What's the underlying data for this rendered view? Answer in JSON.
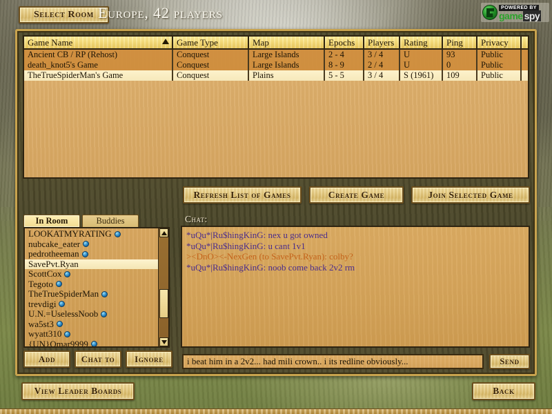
{
  "topbar": {
    "select_room_label": "Select Room",
    "room_title": "Europe, 42 players",
    "logo": {
      "powered_by": "POWERED BY",
      "brand_game": "game",
      "brand_spy": "spy",
      "icon": "gamespy-orb-icon"
    }
  },
  "gamelist": {
    "columns": [
      {
        "label": "Game Name",
        "sorted": true,
        "sort_dir": "asc"
      },
      {
        "label": "Game Type",
        "sorted": false
      },
      {
        "label": "Map",
        "sorted": false
      },
      {
        "label": "Epochs",
        "sorted": false
      },
      {
        "label": "Players",
        "sorted": false
      },
      {
        "label": "Rating",
        "sorted": false
      },
      {
        "label": "Ping",
        "sorted": false
      },
      {
        "label": "Privacy",
        "sorted": false
      }
    ],
    "rows": [
      {
        "name": "Ancient CB / RP (Rehost)",
        "type": "Conquest",
        "map": "Large Islands",
        "epochs": "2 - 4",
        "players": "3 / 4",
        "rating": "U",
        "ping": "93",
        "privacy": "Public",
        "selected": false
      },
      {
        "name": "death_knot5's Game",
        "type": "Conquest",
        "map": "Large Islands",
        "epochs": "8 - 9",
        "players": "2 / 4",
        "rating": "U",
        "ping": "0",
        "privacy": "Public",
        "selected": false
      },
      {
        "name": "TheTrueSpiderMan's Game",
        "type": "Conquest",
        "map": "Plains",
        "epochs": "5 - 5",
        "players": "3 / 4",
        "rating": "S (1961)",
        "ping": "109",
        "privacy": "Public",
        "selected": true
      }
    ]
  },
  "actions": {
    "refresh_label": "Refresh List of Games",
    "create_label": "Create Game",
    "join_label": "Join Selected Game"
  },
  "players_panel": {
    "tabs": [
      {
        "label": "In Room",
        "active": true
      },
      {
        "label": "Buddies",
        "active": false
      }
    ],
    "players": [
      {
        "name": "LOOKATMYRATING",
        "has_globe": true,
        "selected": false
      },
      {
        "name": "nubcake_eater",
        "has_globe": true,
        "selected": false
      },
      {
        "name": "pedrotheeman",
        "has_globe": true,
        "selected": false
      },
      {
        "name": "SavePvt.Ryan",
        "has_globe": false,
        "selected": true
      },
      {
        "name": "ScottCox",
        "has_globe": true,
        "selected": false
      },
      {
        "name": "Tegoto",
        "has_globe": true,
        "selected": false
      },
      {
        "name": "TheTrueSpiderMan",
        "has_globe": true,
        "selected": false
      },
      {
        "name": "trevdigi",
        "has_globe": true,
        "selected": false
      },
      {
        "name": "U.N.=UselessNoob",
        "has_globe": true,
        "selected": false
      },
      {
        "name": "wa5st3",
        "has_globe": true,
        "selected": false
      },
      {
        "name": "wyatt310",
        "has_globe": true,
        "selected": false
      },
      {
        "name": "{UN}Omar9999",
        "has_globe": true,
        "selected": false
      }
    ],
    "buttons": {
      "add_label": "Add",
      "chat_to_label": "Chat to",
      "ignore_label": "Ignore"
    },
    "scrollbar": {
      "up_icon": "scroll-up-arrow-icon",
      "down_icon": "scroll-down-arrow-icon"
    }
  },
  "chat": {
    "label": "Chat:",
    "messages": [
      {
        "text": "*uQu*|Ru$hingKinG: nex u got owned",
        "color": "#4a2c8c"
      },
      {
        "text": "*uQu*|Ru$hingKinG: u cant 1v1",
        "color": "#4a2c8c"
      },
      {
        "text": "><DnO><-NexGen (to SavePvt.Ryan): colby?",
        "color": "#c4631a"
      },
      {
        "text": "*uQu*|Ru$hingKinG: noob come back 2v2 rm",
        "color": "#4a2c8c"
      }
    ],
    "input_value": "i beat him in a 2v2... had mili crown.. i its redline obviously...",
    "input_placeholder": "",
    "send_label": "Send"
  },
  "footer": {
    "leader_boards_label": "View Leader Boards",
    "back_label": "Back"
  },
  "colors": {
    "accent_gold": "#c8a34e",
    "panel_dark": "#4e4a2c",
    "list_bg": "#d7a762",
    "selection": "#fdf2cc",
    "chat_public": "#4a2c8c",
    "chat_private": "#c4631a"
  }
}
